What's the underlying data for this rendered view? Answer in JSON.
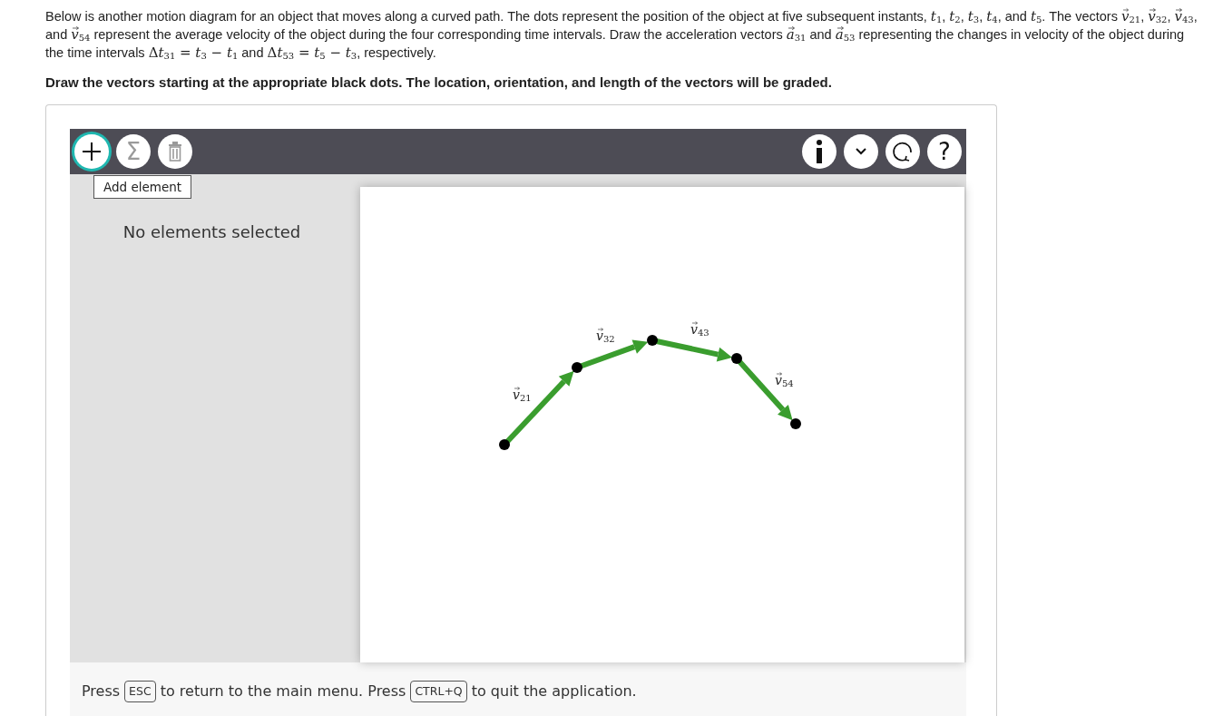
{
  "question": [
    {
      "kind": "text",
      "text": "Below is another motion diagram for an object that moves along a curved path. The dots represent the position of the object at five subsequent instants, "
    },
    {
      "kind": "var",
      "symbol": "t",
      "subscript": "1"
    },
    {
      "kind": "text",
      "text": ", "
    },
    {
      "kind": "var",
      "symbol": "t",
      "subscript": "2"
    },
    {
      "kind": "text",
      "text": ", "
    },
    {
      "kind": "var",
      "symbol": "t",
      "subscript": "3"
    },
    {
      "kind": "text",
      "text": ", "
    },
    {
      "kind": "var",
      "symbol": "t",
      "subscript": "4"
    },
    {
      "kind": "text",
      "text": ", and "
    },
    {
      "kind": "var",
      "symbol": "t",
      "subscript": "5"
    },
    {
      "kind": "text",
      "text": ". The vectors "
    },
    {
      "kind": "vector",
      "symbol": "v",
      "subscript": "21"
    },
    {
      "kind": "text",
      "text": ", "
    },
    {
      "kind": "vector",
      "symbol": "v",
      "subscript": "32"
    },
    {
      "kind": "text",
      "text": ", "
    },
    {
      "kind": "vector",
      "symbol": "v",
      "subscript": "43"
    },
    {
      "kind": "text",
      "text": ", and "
    },
    {
      "kind": "vector",
      "symbol": "v",
      "subscript": "54"
    },
    {
      "kind": "text",
      "text": " represent the average velocity of the object during the four corresponding time intervals. Draw the acceleration vectors "
    },
    {
      "kind": "vector",
      "symbol": "a",
      "subscript": "31"
    },
    {
      "kind": "text",
      "text": " and "
    },
    {
      "kind": "vector",
      "symbol": "a",
      "subscript": "53"
    },
    {
      "kind": "text",
      "text": " representing the changes in velocity of the object during the time intervals "
    },
    {
      "kind": "math",
      "text": "Δ"
    },
    {
      "kind": "var",
      "symbol": "t",
      "subscript": "31"
    },
    {
      "kind": "math",
      "text": " = "
    },
    {
      "kind": "var",
      "symbol": "t",
      "subscript": "3"
    },
    {
      "kind": "math",
      "text": " − "
    },
    {
      "kind": "var",
      "symbol": "t",
      "subscript": "1"
    },
    {
      "kind": "text",
      "text": " and "
    },
    {
      "kind": "math",
      "text": "Δ"
    },
    {
      "kind": "var",
      "symbol": "t",
      "subscript": "53"
    },
    {
      "kind": "math",
      "text": " = "
    },
    {
      "kind": "var",
      "symbol": "t",
      "subscript": "5"
    },
    {
      "kind": "math",
      "text": " − "
    },
    {
      "kind": "var",
      "symbol": "t",
      "subscript": "3"
    },
    {
      "kind": "text",
      "text": ", respectively."
    }
  ],
  "instruction": "Draw the vectors starting at the appropriate black dots. The location, orientation, and length of the vectors will be graded.",
  "toolbar": {
    "left": [
      {
        "kind": "add",
        "disabled": false,
        "focused": true
      },
      {
        "kind": "sum",
        "symbol": "Σ",
        "disabled": true,
        "focused": false
      },
      {
        "kind": "delete",
        "disabled": true,
        "focused": false
      }
    ],
    "right": [
      {
        "kind": "info",
        "disabled": false,
        "focused": false
      },
      {
        "kind": "expand",
        "disabled": false,
        "focused": false
      },
      {
        "kind": "reset",
        "disabled": false,
        "focused": false
      },
      {
        "kind": "help",
        "symbol": "?",
        "disabled": false,
        "focused": false
      }
    ],
    "tooltip": "Add element"
  },
  "side_panel": {
    "message": "No elements selected"
  },
  "diagram": {
    "vectors": [
      {
        "symbol": "v",
        "subscript": "21"
      },
      {
        "symbol": "v",
        "subscript": "32"
      },
      {
        "symbol": "v",
        "subscript": "43"
      },
      {
        "symbol": "v",
        "subscript": "54"
      }
    ]
  },
  "footer": [
    {
      "kind": "text",
      "text": "Press"
    },
    {
      "kind": "key",
      "text": "ESC"
    },
    {
      "kind": "text",
      "text": "to return to the main menu. Press"
    },
    {
      "kind": "key",
      "text": "CTRL+Q"
    },
    {
      "kind": "text",
      "text": "to quit the application."
    }
  ]
}
